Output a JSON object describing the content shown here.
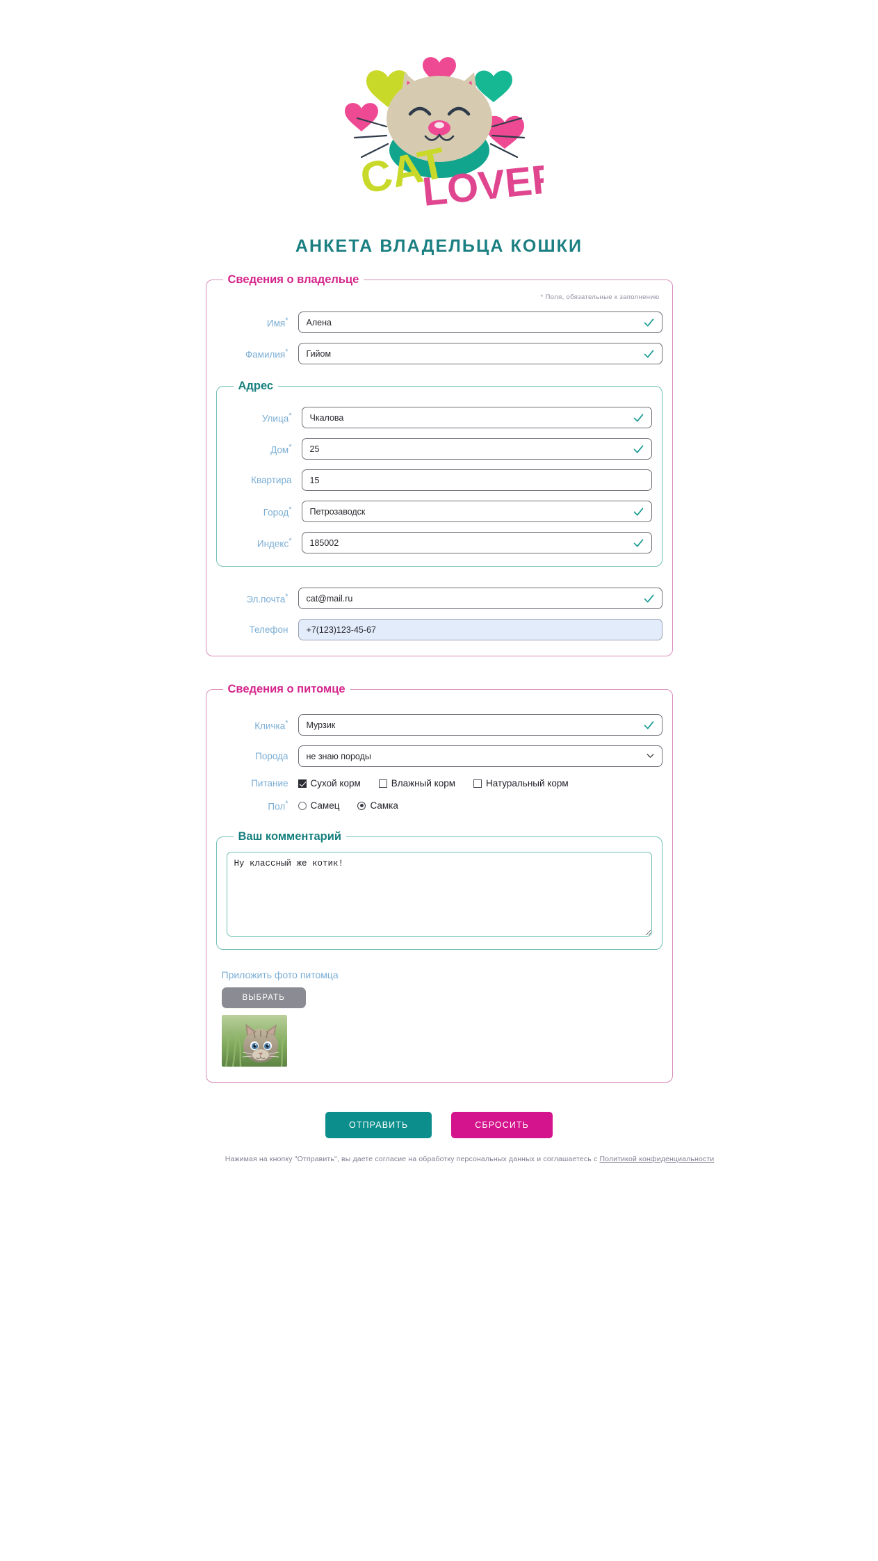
{
  "logo": {
    "brand_word_1": "CAT",
    "brand_word_2": "LOVER",
    "colors": {
      "cat_face": "#d6cbb0",
      "cat_collar": "#12a58e",
      "heart_pink": "#ee4a93",
      "heart_lime": "#c9d92a",
      "heart_teal": "#16b894",
      "word_1": "#c9d92a",
      "word_2": "#e0458f"
    }
  },
  "title": "АНКЕТА ВЛАДЕЛЬЦА КОШКИ",
  "owner": {
    "legend": "Сведения о владельце",
    "required_note": "* Поля, обязательные к заполнению",
    "fields": [
      {
        "label": "Имя",
        "required": true,
        "value": "Алена",
        "valid": true
      },
      {
        "label": "Фамилия",
        "required": true,
        "value": "Гийом",
        "valid": true
      }
    ],
    "address": {
      "legend": "Адрес",
      "fields": [
        {
          "label": "Улица",
          "required": true,
          "value": "Чкалова",
          "valid": true
        },
        {
          "label": "Дом",
          "required": true,
          "value": "25",
          "valid": true
        },
        {
          "label": "Квартира",
          "required": false,
          "value": "15",
          "valid": false
        },
        {
          "label": "Город",
          "required": true,
          "value": "Петрозаводск",
          "valid": true
        },
        {
          "label": "Индекс",
          "required": true,
          "value": "185002",
          "valid": true
        }
      ]
    },
    "contact": [
      {
        "label": "Эл.почта",
        "required": true,
        "value": "cat@mail.ru",
        "valid": true
      },
      {
        "label": "Телефон",
        "required": false,
        "value": "+7(123)123-45-67",
        "valid": false,
        "focused": true
      }
    ]
  },
  "pet": {
    "legend": "Сведения о питомце",
    "nickname": {
      "label": "Кличка",
      "required": true,
      "value": "Мурзик",
      "valid": true
    },
    "breed": {
      "label": "Порода",
      "required": false,
      "value": "не знаю породы",
      "options": [
        "не знаю породы"
      ]
    },
    "food": {
      "label": "Питание",
      "options": [
        {
          "label": "Сухой корм",
          "checked": true
        },
        {
          "label": "Влажный корм",
          "checked": false
        },
        {
          "label": "Натуральный корм",
          "checked": false
        }
      ]
    },
    "sex": {
      "label": "Пол",
      "required": true,
      "options": [
        {
          "label": "Самец",
          "selected": false
        },
        {
          "label": "Самка",
          "selected": true
        }
      ]
    },
    "comment": {
      "legend": "Ваш комментарий",
      "value": "Ну классный же котик!"
    },
    "upload": {
      "label": "Приложить фото питомца",
      "button": "ВЫБРАТЬ",
      "thumbnail_alt": "kitten-photo"
    }
  },
  "actions": {
    "submit": "ОТПРАВИТЬ",
    "reset": "СБРОСИТЬ"
  },
  "footer": {
    "text_before": "Нажимая на кнопку \"Отправить\", вы даете согласие на обработку персональных данных и соглашаетесь с ",
    "link": "Политикой конфиденциальности"
  },
  "icons": {
    "valid": "check-icon",
    "select": "chevron-down-icon"
  }
}
